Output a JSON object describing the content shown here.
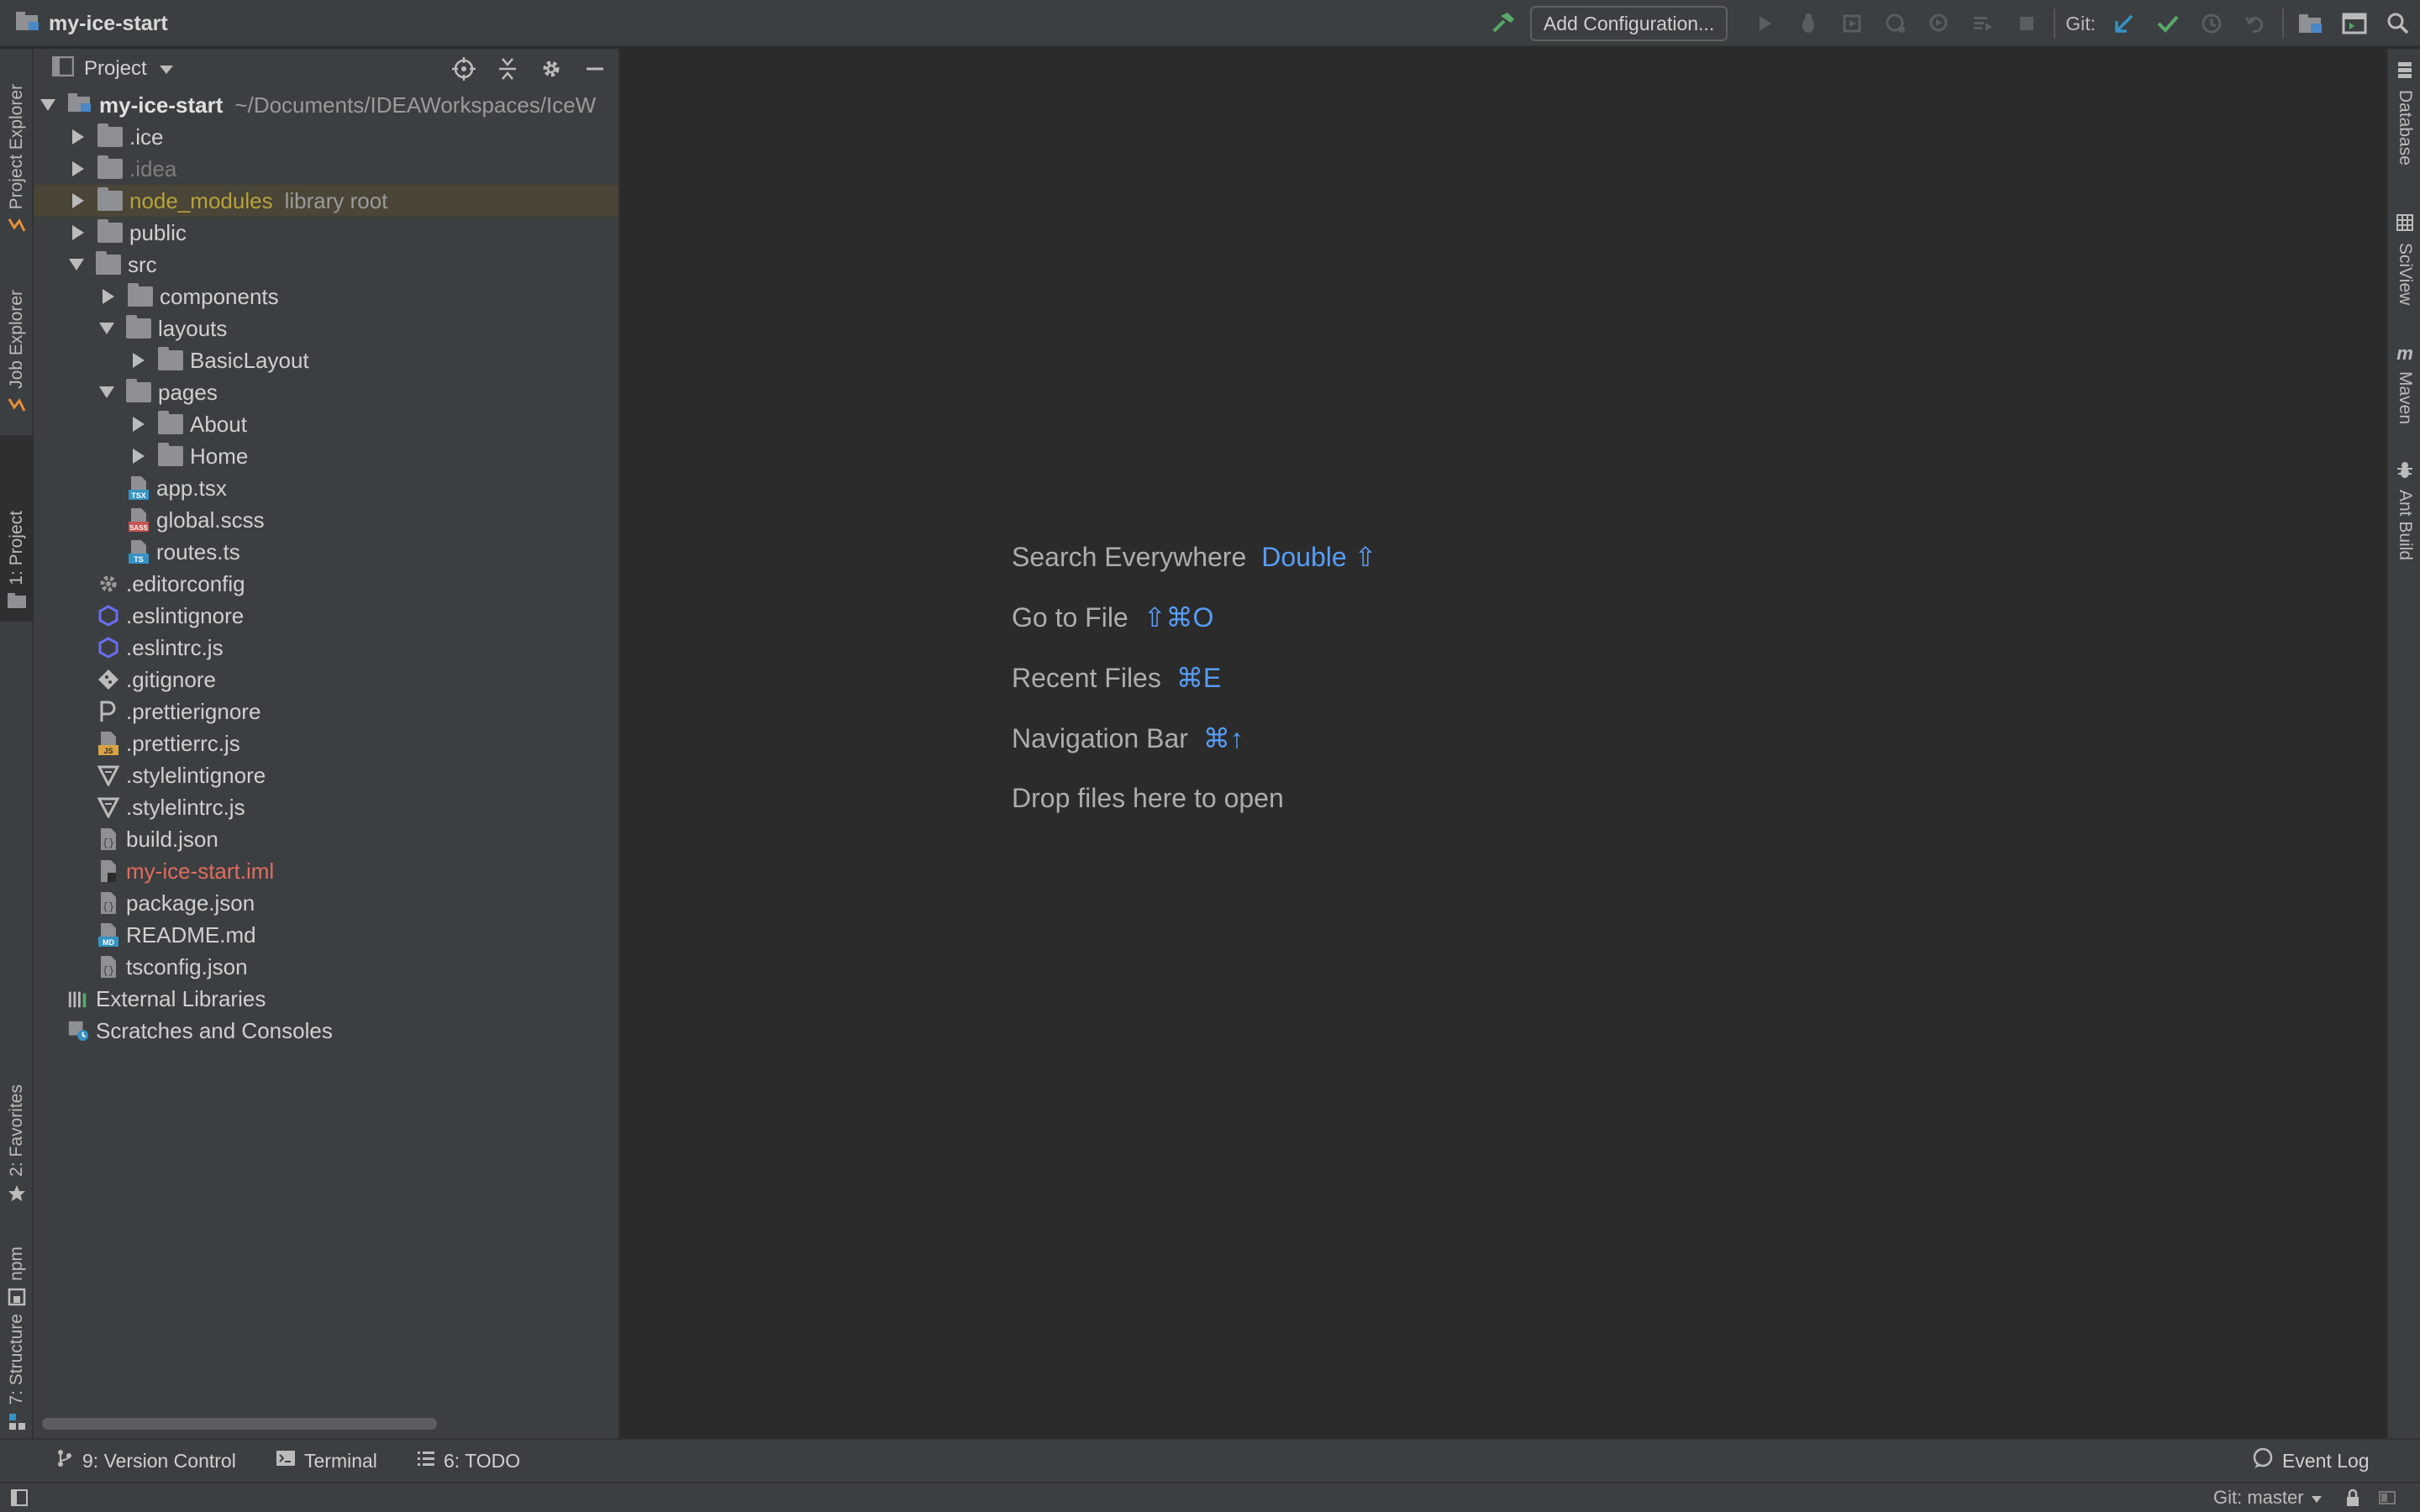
{
  "titlebar": {
    "project_name": "my-ice-start",
    "add_configuration": "Add Configuration...",
    "git_label": "Git:"
  },
  "left_strip": {
    "tabs": [
      {
        "label": "Project Explorer"
      },
      {
        "label": "Job Explorer"
      },
      {
        "label": "1: Project"
      },
      {
        "label": "2: Favorites"
      },
      {
        "label": "npm"
      },
      {
        "label": "7: Structure"
      }
    ]
  },
  "right_strip": {
    "tabs": [
      {
        "label": "Database"
      },
      {
        "label": "SciView"
      },
      {
        "label": "Maven"
      },
      {
        "label": "Ant Build"
      }
    ]
  },
  "project_panel": {
    "title": "Project",
    "root": {
      "name": "my-ice-start",
      "path": "~/Documents/IDEAWorkspaces/IceW"
    },
    "items": [
      {
        "name": ".ice"
      },
      {
        "name": ".idea"
      },
      {
        "name": "node_modules",
        "suffix": "library root"
      },
      {
        "name": "public"
      },
      {
        "name": "src"
      },
      {
        "name": "components"
      },
      {
        "name": "layouts"
      },
      {
        "name": "BasicLayout"
      },
      {
        "name": "pages"
      },
      {
        "name": "About"
      },
      {
        "name": "Home"
      },
      {
        "name": "app.tsx",
        "badge": "TSX"
      },
      {
        "name": "global.scss",
        "badge": "SASS"
      },
      {
        "name": "routes.ts",
        "badge": "TS"
      },
      {
        "name": ".editorconfig"
      },
      {
        "name": ".eslintignore"
      },
      {
        "name": ".eslintrc.js"
      },
      {
        "name": ".gitignore"
      },
      {
        "name": ".prettierignore"
      },
      {
        "name": ".prettierrc.js",
        "badge": "JS"
      },
      {
        "name": ".stylelintignore"
      },
      {
        "name": ".stylelintrc.js"
      },
      {
        "name": "build.json"
      },
      {
        "name": "my-ice-start.iml"
      },
      {
        "name": "package.json"
      },
      {
        "name": "README.md",
        "badge": "MD"
      },
      {
        "name": "tsconfig.json"
      },
      {
        "name": "External Libraries"
      },
      {
        "name": "Scratches and Consoles"
      }
    ]
  },
  "editor_hints": [
    {
      "label": "Search Everywhere",
      "key": "Double ⇧"
    },
    {
      "label": "Go to File",
      "key": "⇧⌘O"
    },
    {
      "label": "Recent Files",
      "key": "⌘E"
    },
    {
      "label": "Navigation Bar",
      "key": "⌘↑"
    },
    {
      "label": "Drop files here to open",
      "key": ""
    }
  ],
  "bottom_tabs": {
    "version_control": "9: Version Control",
    "terminal": "Terminal",
    "todo": "6: TODO",
    "event_log": "Event Log"
  },
  "status": {
    "git_branch": "Git: master"
  },
  "colors": {
    "accent_blue": "#589df6",
    "library_yellow": "#b5a33c",
    "iml_red": "#e06c5f",
    "ignored_gray": "#7d7d7d",
    "highlight_row": "#4a4536"
  }
}
